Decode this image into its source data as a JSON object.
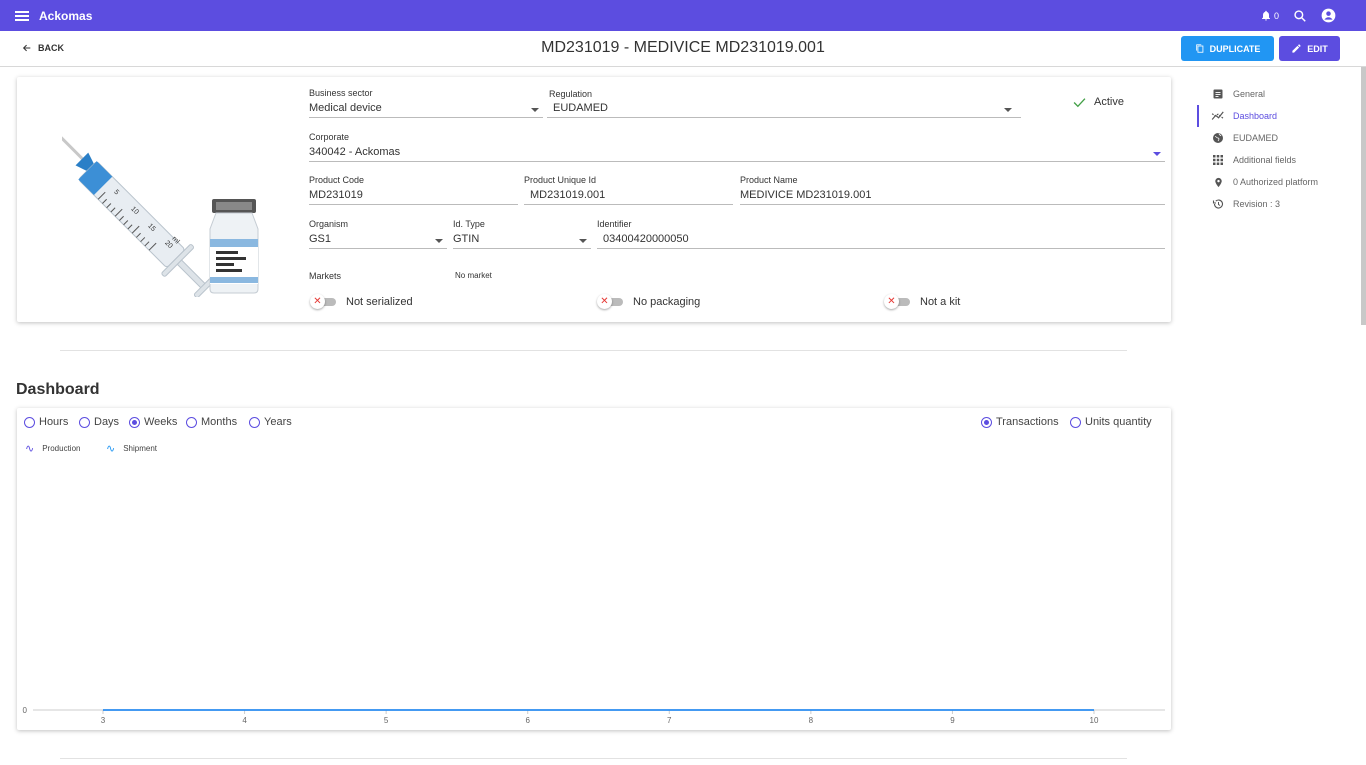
{
  "app": {
    "name": "Ackomas",
    "notifications_count": "0"
  },
  "header": {
    "back_label": "BACK",
    "title": "MD231019 - MEDIVICE MD231019.001",
    "duplicate_label": "DUPLICATE",
    "edit_label": "EDIT"
  },
  "product": {
    "business_sector": {
      "label": "Business sector",
      "value": "Medical device"
    },
    "regulation": {
      "label": "Regulation",
      "value": "EUDAMED"
    },
    "status": "Active",
    "corporate": {
      "label": "Corporate",
      "value": "340042 - Ackomas"
    },
    "product_code": {
      "label": "Product Code",
      "value": "MD231019"
    },
    "product_unique_id": {
      "label": "Product Unique Id",
      "value": "MD231019.001"
    },
    "product_name": {
      "label": "Product Name",
      "value": "MEDIVICE MD231019.001"
    },
    "organism": {
      "label": "Organism",
      "value": "GS1"
    },
    "id_type": {
      "label": "Id. Type",
      "value": "GTIN"
    },
    "identifier": {
      "label": "Identifier",
      "value": "03400420000050"
    },
    "markets": {
      "label": "Markets",
      "value": "No market"
    },
    "toggles": [
      "Not serialized",
      "No packaging",
      "Not a kit"
    ],
    "image_markings": [
      "5",
      "10",
      "15",
      "20",
      "ml"
    ]
  },
  "dashboard": {
    "title": "Dashboard",
    "periods": [
      "Hours",
      "Days",
      "Weeks",
      "Months",
      "Years"
    ],
    "selected_period": "Weeks",
    "metrics": [
      "Transactions",
      "Units quantity"
    ],
    "selected_metric": "Transactions",
    "legend": [
      "Production",
      "Shipment"
    ],
    "accent_color": "#5c4de0",
    "series_color": "#2196f3"
  },
  "chart_data": {
    "type": "line",
    "x": [
      3,
      4,
      5,
      6,
      7,
      8,
      9,
      10
    ],
    "series": [
      {
        "name": "Production",
        "values": [
          0,
          0,
          0,
          0,
          0,
          0,
          0,
          0
        ]
      },
      {
        "name": "Shipment",
        "values": [
          0,
          0,
          0,
          0,
          0,
          0,
          0,
          0
        ]
      }
    ],
    "y_ticks": [
      0
    ],
    "xlabel": "",
    "ylabel": ""
  },
  "sidebar": {
    "items": [
      {
        "label": "General",
        "icon": "document-icon"
      },
      {
        "label": "Dashboard",
        "icon": "chart-line-icon"
      },
      {
        "label": "EUDAMED",
        "icon": "globe-icon"
      },
      {
        "label": "Additional fields",
        "icon": "grid-icon"
      },
      {
        "label": "0 Authorized platform",
        "icon": "location-pin-icon"
      },
      {
        "label": "Revision : 3",
        "icon": "history-icon"
      }
    ],
    "active": "Dashboard"
  }
}
